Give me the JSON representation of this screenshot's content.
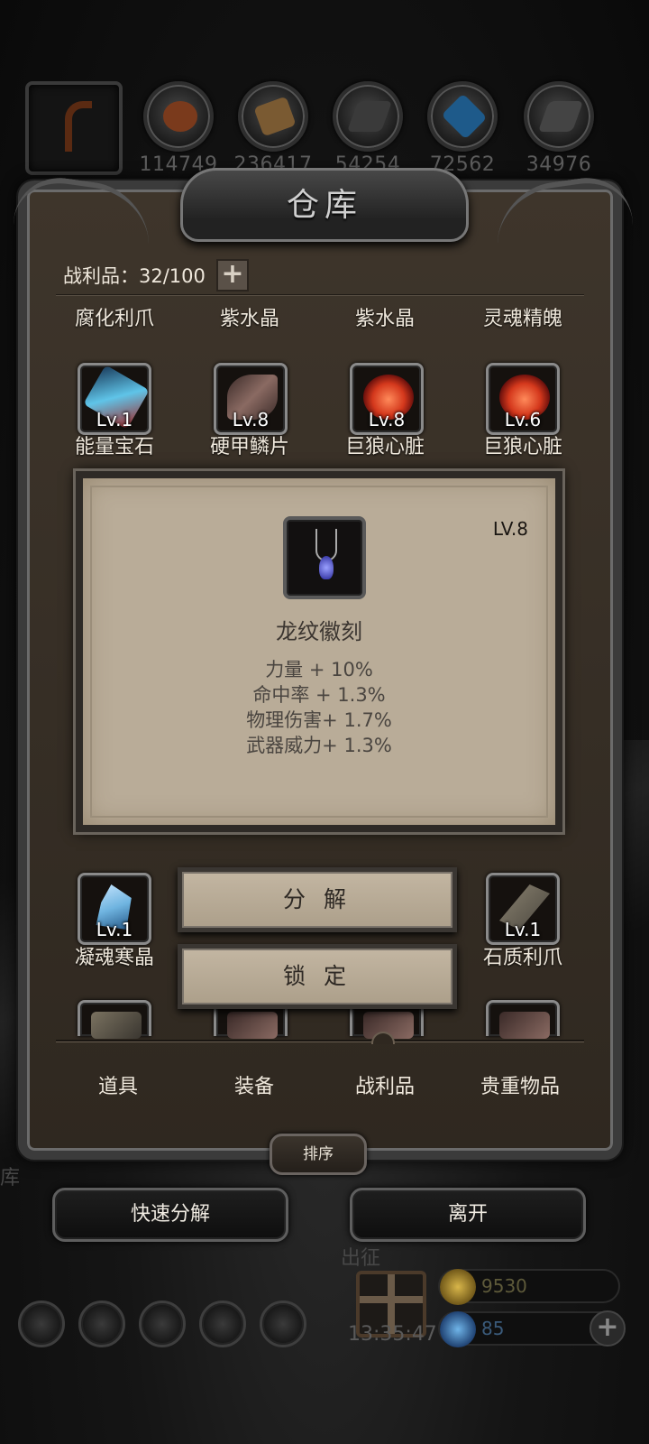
{
  "resources": [
    {
      "icon": "rusty-hook-icon",
      "count": ""
    },
    {
      "icon": "meat-icon",
      "count": "114749"
    },
    {
      "icon": "wood-plank-icon",
      "count": "236417"
    },
    {
      "icon": "iron-ingot-icon",
      "count": "54254"
    },
    {
      "icon": "blue-crystal-icon",
      "count": "72562"
    },
    {
      "icon": "steel-ingot-icon",
      "count": "34976"
    }
  ],
  "panel": {
    "title": "仓库",
    "spoils_label": "战利品：32/100",
    "add_label": "+"
  },
  "top_names": [
    "腐化利爪",
    "紫水晶",
    "紫水晶",
    "灵魂精魄"
  ],
  "row2": [
    {
      "level": "Lv.1",
      "name": "能量宝石",
      "icon": "energy-gem-icon",
      "color": "#5fc4e8"
    },
    {
      "level": "Lv.8",
      "name": "硬甲鳞片",
      "icon": "scale-icon",
      "color": "#6b4a44"
    },
    {
      "level": "Lv.8",
      "name": "巨狼心脏",
      "icon": "wolf-heart-icon",
      "color": "#d4381c"
    },
    {
      "level": "Lv.6",
      "name": "巨狼心脏",
      "icon": "wolf-heart-icon",
      "color": "#d4381c"
    }
  ],
  "detail": {
    "level": "LV.8",
    "name": "龙纹徽刻",
    "stats": [
      "力量 + 10%",
      "命中率 + 1.3%",
      "物理伤害+ 1.7%",
      "武器威力+ 1.3%"
    ]
  },
  "row4": [
    {
      "level": "Lv.1",
      "name": "凝魂寒晶",
      "icon": "frost-crystal-icon",
      "color": "#6fb4e0"
    },
    {
      "level": "Lv.1",
      "name": "石质利爪",
      "icon": "stone-claw-icon",
      "color": "#6a6456"
    }
  ],
  "actions": {
    "decompose": "分 解",
    "lock": "锁 定"
  },
  "tabs": [
    "道具",
    "装备",
    "战利品",
    "贵重物品"
  ],
  "sort_label": "排序",
  "quick_decompose": "快速分解",
  "leave": "离开",
  "faded": {
    "left_char": "库",
    "expedition": "出征"
  },
  "hud": {
    "timer": "13:35:47",
    "gold": "9530",
    "gems": "85",
    "plus": "+"
  },
  "colors": {
    "gold_coin": "#b8912a",
    "gem_coin": "#2f7fc2"
  }
}
